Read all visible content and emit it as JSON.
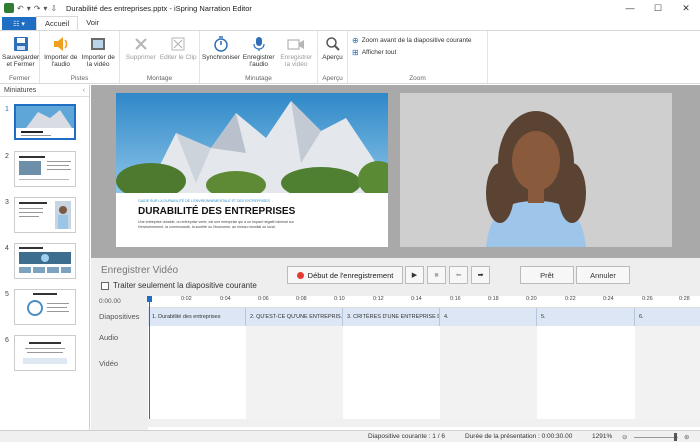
{
  "window": {
    "title": "Durabilité des entreprises.pptx - iSpring Narration Editor",
    "controls": [
      "—",
      "☐",
      "✕"
    ]
  },
  "ribbon_tabs": {
    "file_label": "☷ ▾",
    "tabs": [
      "Accueil",
      "Voir"
    ]
  },
  "ribbon": {
    "groups": {
      "close": "Fermer",
      "tracks": "Pistes",
      "edit": "Montage",
      "timing": "Minutage",
      "preview": "Aperçu",
      "zoom": "Zoom"
    },
    "buttons": {
      "save_close": "Sauvegarder et Fermer",
      "import_audio": "Importer de l'audio",
      "import_video": "Importer de la vidéo",
      "delete": "Supprimer",
      "edit_clip": "Editer le Clip",
      "sync": "Synchroniser",
      "record_audio": "Enregistrer l'audio",
      "record_video": "Enregistrer la vidéo",
      "preview": "Aperçu",
      "zoom_current": "Zoom avant de la diapositive courante",
      "show_all": "Afficher tout"
    }
  },
  "thumbnails": {
    "header": "Miniatures",
    "items": [
      "1",
      "2",
      "3",
      "4",
      "5",
      "6"
    ]
  },
  "slide": {
    "subtitle": "GUIDE SUR LA DURABILITÉ DE L'ENVIRONNEMENTALE ET DES ENTREPRISES",
    "title": "DURABILITÉ DES ENTREPRISES",
    "body": "Une entreprise durable, ou entreprise verte, est une entreprise qui a un impact négatif minimal sur l'environnement, la communauté, la société ou l'économie, au niveau mondial ou local."
  },
  "recording": {
    "title": "Enregistrer Vidéo",
    "only_current": "Traiter seulement la diapositive courante",
    "start_label": "Début de l'enregistrement",
    "ok_label": "Prêt",
    "cancel_label": "Annuler",
    "controls": [
      "▶",
      "■",
      "⬅",
      "➡"
    ]
  },
  "timeline": {
    "current_time": "0:00.00",
    "labels": {
      "slides": "Diapositives",
      "audio": "Audio",
      "video": "Vidéo"
    },
    "ticks": [
      "0:02",
      "0:04",
      "0:06",
      "0:08",
      "0:10",
      "0:12",
      "0:14",
      "0:16",
      "0:18",
      "0:20",
      "0:22",
      "0:24",
      "0:26",
      "0:28"
    ],
    "segments": [
      "1. Durabilité des entreprises",
      "2. QU'EST-CE QU'UNE ENTREPRIS...",
      "3. CRITÈRES D'UNE ENTREPRISE D...",
      "4.",
      "5.",
      "6."
    ]
  },
  "status": {
    "current_slide": "Diapositive courante : 1 / 6",
    "duration": "Durée de la présentation : 0:00:30.00",
    "zoom": "1291%"
  },
  "colors": {
    "accent": "#1e6fc3",
    "record": "#e53935",
    "preview_bg": "#a9a9a9",
    "slides_strip": "#dce6f4"
  }
}
